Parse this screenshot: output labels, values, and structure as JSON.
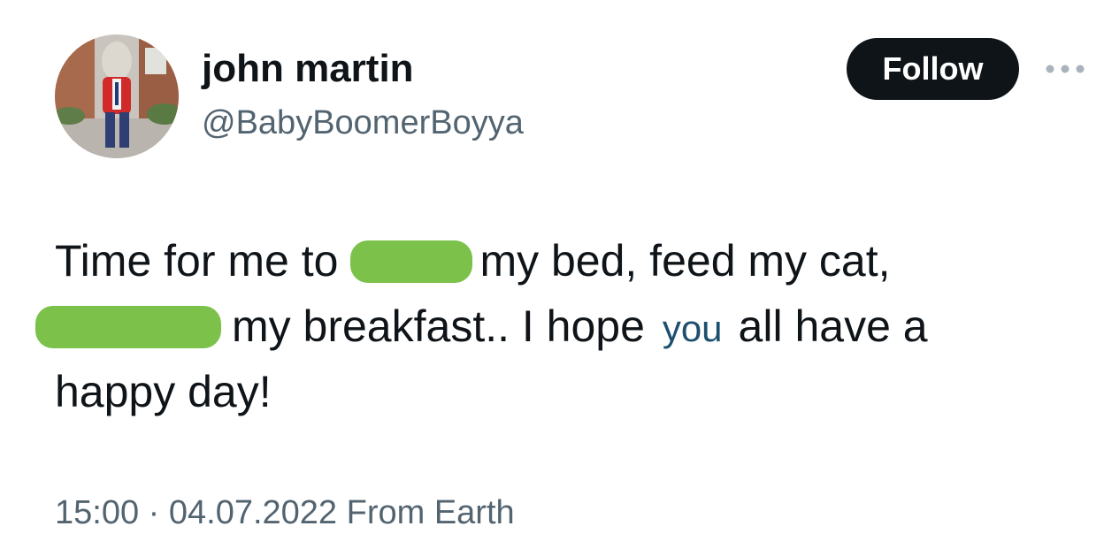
{
  "author": {
    "display_name": "john martin",
    "handle": "@BabyBoomerBoyya",
    "avatar_icon": "profile-avatar-dinosaur-statue"
  },
  "actions": {
    "follow_label": "Follow",
    "more_icon": "more-dots-icon"
  },
  "tweet": {
    "line1_before": "Time for me to",
    "line1_after": "my bed, feed my cat,",
    "line2_after_a": "my breakfast.. I hope",
    "line2_inserted": "you",
    "line2_after_b": "all have a",
    "line3": "happy day!",
    "redaction_color": "#7bc14a",
    "inserted_word_color": "#1d4f6e"
  },
  "meta": {
    "timestamp": "15:00 · 04.07.2022 From Earth"
  }
}
